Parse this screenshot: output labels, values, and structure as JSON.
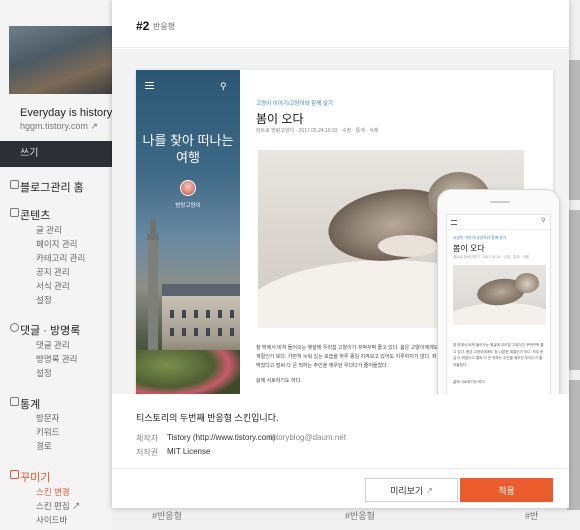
{
  "sidebar": {
    "blog_title": "Everyday is history",
    "blog_url": "hggm.tistory.com",
    "write_label": "쓰기",
    "sections": [
      {
        "label": "블로그관리 홈",
        "items": []
      },
      {
        "label": "콘텐츠",
        "items": [
          "글 관리",
          "페이지 관리",
          "카테고리 관리",
          "공지 관리",
          "서식 관리",
          "설정"
        ]
      },
      {
        "label": "댓글 · 방명록",
        "items": [
          "댓글 관리",
          "방명록 관리",
          "설정"
        ]
      },
      {
        "label": "통계",
        "items": [
          "방문자",
          "키워드",
          "경로"
        ]
      },
      {
        "label": "꾸미기",
        "items": [
          "스킨 변경",
          "스킨 편집",
          "사이드바"
        ]
      }
    ]
  },
  "background": {
    "tags": [
      "#반응형",
      "#반응형",
      "#반"
    ]
  },
  "modal": {
    "skin_number": "#2",
    "skin_name": "반응형",
    "description": "티스토리의 두번째 반응형 스킨입니다.",
    "maker_label": "제작자",
    "maker_value": "Tistory (http://www.tistory.com)",
    "maker_email": "tistoryblog@daum.net",
    "license_label": "저작권",
    "license_value": "MIT License",
    "preview_button": "미리보기",
    "apply_button": "적용",
    "accent_color": "#ec5b2c"
  },
  "mock": {
    "blog_heading": "나를 찾아 떠나는 여행",
    "profile_name": "방랑고양이",
    "category": "고양이 이야기/고양이와 함께 살기",
    "post_title": "봄이 오다",
    "post_meta": "레트로 방랑고양이 · 2017.05.24 16:33 · 수정 · 통계 · 삭제",
    "post_body": "창 밖에서 비쳐 들어오는 햇살에 우리집 고양이가 꾸벅꾸벅 졸고 있다. 봄은 고양이에게도 참 나른한 계절인가 보다. 가만히 누워 있는 모습을 하루 종일 지켜보고 있어도 지루하지가 않다. 저무 한 살 더 먹었다고 벌써 다 큰 척하는 주인을 깨우던 우다다가 줄어들었다.",
    "post_closing": "삶에 서로하기도 하다.",
    "phone_category": "고양이 이야기/고양이와 함께 살기",
    "phone_title": "봄이 오다",
    "phone_meta": "레트로 방랑고양이 · 2017.05.24 · 수정 · 통계 · 삭제",
    "phone_body": "창 밖에서 비쳐 들어오는 햇살에 우리집 고양이가 꾸벅꾸벅 졸고 있다. 봄은 고양이에게도 참 나른한 계절인가 보다. 저무 한 살 더 먹었다고 벌써 다 큰 척하는 주인을 깨우던 우다다가 줄어들었다.",
    "phone_closing": "삶에 서로하기도 하다"
  }
}
